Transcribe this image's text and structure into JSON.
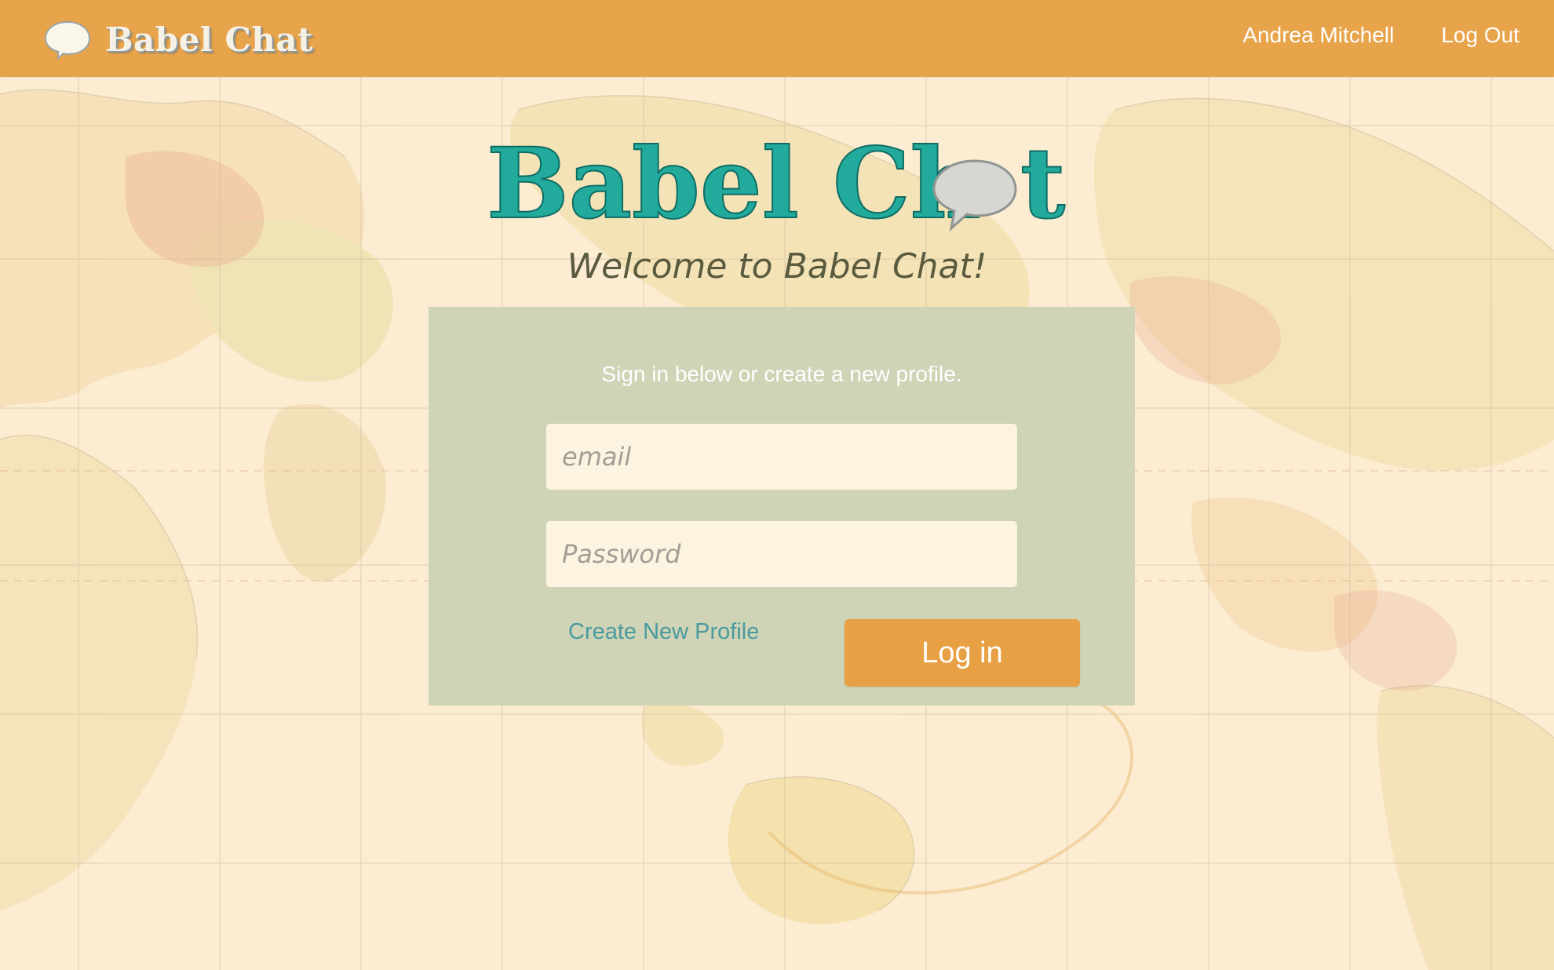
{
  "navbar": {
    "brand_name": "Babel Chat",
    "brand_icon": "speech-bubble-icon",
    "user_name": "Andrea Mitchell",
    "logout_label": "Log Out"
  },
  "hero": {
    "logo_text": "Babel Ch",
    "logo_text_tail": "t",
    "logo_icon": "speech-bubble-icon",
    "welcome": "Welcome to Babel Chat!"
  },
  "login": {
    "subtitle": "Sign in below or create a new profile.",
    "email_placeholder": "email",
    "password_placeholder": "Password",
    "create_profile_label": "Create New Profile",
    "login_label": "Log in"
  },
  "colors": {
    "navbar": "#e8a44b",
    "panel": "#cfd4b6",
    "accent_teal": "#22aa9c",
    "button": "#e8a044",
    "link": "#4a9aa0",
    "input_bg": "#fcf3e1"
  }
}
